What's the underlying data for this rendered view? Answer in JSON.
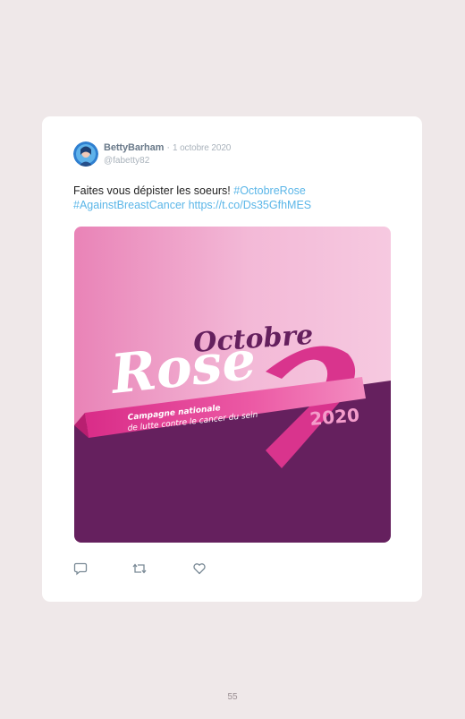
{
  "tweet": {
    "display_name": "BettyBarham",
    "separator": "·",
    "date": "1 octobre 2020",
    "handle": "@fabetty82",
    "text_plain": "Faites vous dépister les soeurs! ",
    "hashtag_1": "#OctobreRose",
    "hashtag_2": "#AgainstBreastCancer",
    "link": "https://t.co/Ds35GfhMES"
  },
  "media": {
    "title_line1": "Octobre",
    "title_line2": "Rose",
    "ribbon_line1": "Campagne nationale",
    "ribbon_line2": "de lutte contre le cancer du sein",
    "year": "2020"
  },
  "actions": {
    "reply_icon": "reply-icon",
    "retweet_icon": "retweet-icon",
    "like_icon": "heart-icon"
  },
  "page_number": "55",
  "colors": {
    "background": "#efe8e9",
    "link": "#5bb6e8",
    "purple": "#65205e",
    "pink": "#e2489a"
  }
}
